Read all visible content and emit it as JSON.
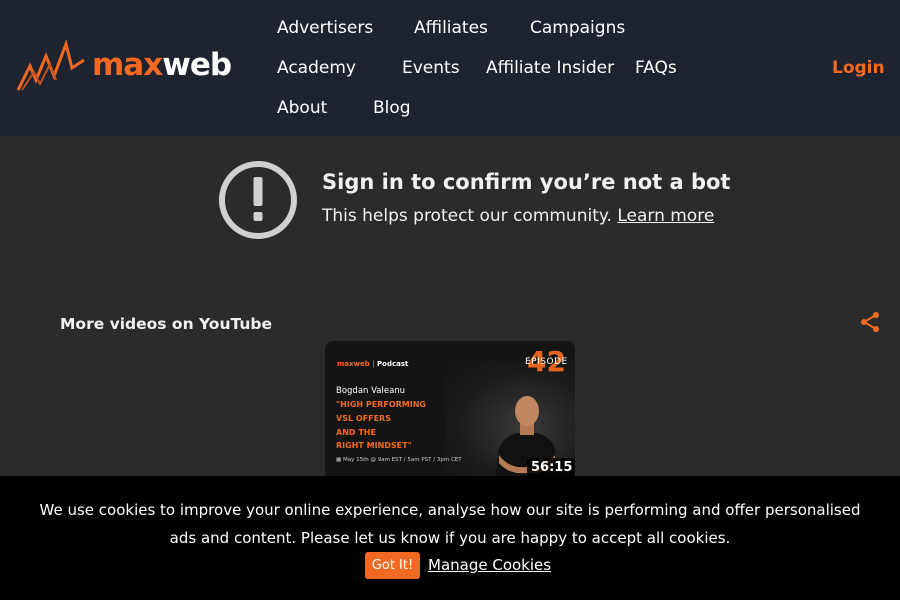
{
  "header": {
    "logo": {
      "max": "max",
      "web": "web"
    },
    "nav": [
      {
        "label": "Advertisers"
      },
      {
        "label": "Affiliates"
      },
      {
        "label": "Campaigns"
      },
      {
        "label": "Academy"
      },
      {
        "label": "Events"
      },
      {
        "label": "Affiliate Insider"
      },
      {
        "label": "FAQs"
      },
      {
        "label": "About"
      },
      {
        "label": "Blog"
      }
    ],
    "login": "Login"
  },
  "embed": {
    "title": "Sign in to confirm you’re not a bot",
    "subtitle": "This helps protect our community.",
    "learn_more": "Learn more",
    "more_videos": "More videos on YouTube",
    "share_icon": "share-icon",
    "warning_icon": "exclamation-circle-icon",
    "thumbnail": {
      "logo_max": "maxweb",
      "logo_sep": "|",
      "logo_tag": "Podcast",
      "episode_label": "EPISODE",
      "episode_number": "42",
      "guest": "Bogdan Valeanu",
      "title_lines": [
        "\"HIGH PERFORMING",
        "VSL OFFERS",
        "AND THE",
        "RIGHT MINDSET\""
      ],
      "date": "May 15th @ 9am EST / 5am PST / 3pm CET",
      "duration": "56:15"
    }
  },
  "cookie": {
    "text": "We use cookies to improve your online experience, analyse how our site is performing and offer personalised ads and content. Please let us know if you are happy to accept all cookies.",
    "accept": "Got It!",
    "manage": "Manage Cookies"
  },
  "colors": {
    "accent": "#f26a21",
    "header_bg": "#1e2330",
    "page_bg": "#2b2b2b",
    "banner_bg": "#000000"
  }
}
